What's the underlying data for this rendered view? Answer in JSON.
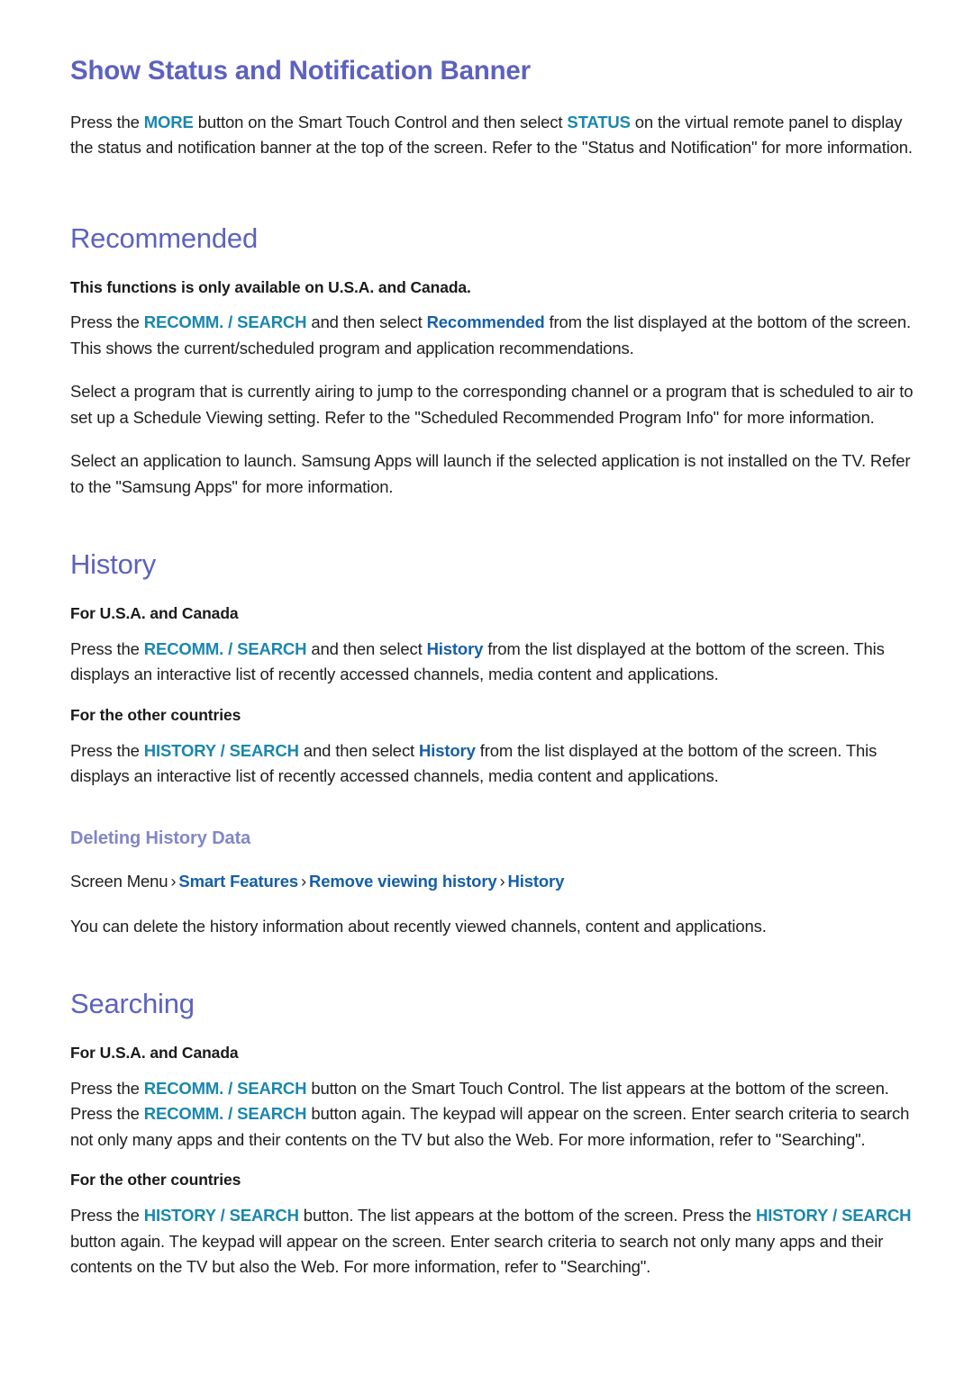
{
  "document": {
    "type": "e-manual-page",
    "colors": {
      "heading_purple": "#5d62be",
      "subheading_purple": "#8287c6",
      "remote_key_teal": "#1a87ad",
      "menu_blue": "#155fa6",
      "body_text": "#1f1f1f",
      "background": "#ffffff"
    }
  },
  "sections": {
    "status_banner": {
      "title": "Show Status and Notification Banner",
      "paragraph": {
        "p1": "Press the ",
        "key1": "MORE",
        "p2": " button on the Smart Touch Control and then select ",
        "key2": "STATUS",
        "p3": " on the virtual remote panel to display the status and notification banner at the top of the screen. Refer to the \"Status and Notification\" for more information."
      }
    },
    "recommended": {
      "title": "Recommended",
      "availability_note": "This functions is only available on U.S.A. and Canada.",
      "para_press": {
        "p1": "Press the ",
        "key1": "RECOMM. / SEARCH",
        "p2": " and then select ",
        "menu1": "Recommended",
        "p3": " from the list displayed at the bottom of the screen. This shows the current/scheduled program and application recommendations."
      },
      "para_select_program": "Select a program that is currently airing to jump to the corresponding channel or a program that is scheduled to air to set up a Schedule Viewing setting. Refer to the \"Scheduled Recommended Program Info\" for more information.",
      "para_select_app": "Select an application to launch. Samsung Apps will launch if the selected application is not installed on the TV. Refer to the \"Samsung Apps\" for more information."
    },
    "history": {
      "title": "History",
      "usa_label": "For U.S.A. and Canada",
      "usa_para": {
        "p1": "Press the ",
        "key1": "RECOMM. / SEARCH",
        "p2": " and then select ",
        "menu1": "History",
        "p3": " from the list displayed at the bottom of the screen. This displays an interactive list of recently accessed channels, media content and applications."
      },
      "other_label": "For the other countries",
      "other_para": {
        "p1": "Press the ",
        "key1": "HISTORY / SEARCH",
        "p2": " and then select ",
        "menu1": "History",
        "p3": " from the list displayed at the bottom of the screen. This displays an interactive list of recently accessed channels, media content and applications."
      },
      "deleting": {
        "title": "Deleting History Data",
        "breadcrumb": {
          "root": "Screen Menu",
          "sep": "›",
          "item1": "Smart Features",
          "item2": "Remove viewing history",
          "item3": "History"
        },
        "description": "You can delete the history information about recently viewed channels, content and applications."
      }
    },
    "searching": {
      "title": "Searching",
      "usa_label": "For U.S.A. and Canada",
      "usa_para": {
        "p1": "Press the ",
        "key1": "RECOMM. / SEARCH",
        "p2": " button on the Smart Touch Control. The list appears at the bottom of the screen. Press the ",
        "key2": "RECOMM. / SEARCH",
        "p3": " button again. The keypad will appear on the screen. Enter search criteria to search not only many apps and their contents on the TV but also the Web. For more information, refer to \"Searching\"."
      },
      "other_label": "For the other countries",
      "other_para": {
        "p1": "Press the ",
        "key1": "HISTORY / SEARCH",
        "p2": " button. The list appears at the bottom of the screen. Press the ",
        "key2": "HISTORY",
        "p3": "",
        "key3": "/ SEARCH",
        "p4": " button again. The keypad will appear on the screen. Enter search criteria to search not only many apps and their contents on the TV but also the Web. For more information, refer to \"Searching\"."
      }
    }
  }
}
